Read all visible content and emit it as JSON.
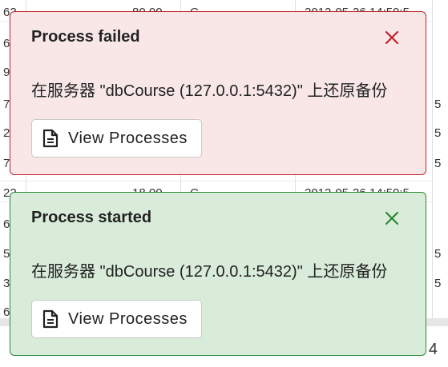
{
  "background": {
    "left_column_fragments": [
      "62",
      "6",
      "9",
      "7",
      "2",
      "7",
      "22",
      "6",
      "5",
      "3",
      "6"
    ],
    "mid_values": [
      "80.00",
      "18.00"
    ],
    "right_values": [
      "2012-05-26 14:59:5",
      "2012-05-26 14:59:5"
    ],
    "mid_letters": [
      "C",
      "C"
    ],
    "right_edge_fragments": [
      "5",
      "5",
      "5",
      "5",
      "5"
    ],
    "page_number": "4"
  },
  "toasts": [
    {
      "title": "Process failed",
      "message": "在服务器 \"dbCourse (127.0.0.1:5432)\" 上还原备份",
      "button_label": "View Processes",
      "close_color": "#c0202b",
      "status": "failed"
    },
    {
      "title": "Process started",
      "message": "在服务器 \"dbCourse (127.0.0.1:5432)\" 上还原备份",
      "button_label": "View Processes",
      "close_color": "#2a8a36",
      "status": "started"
    }
  ]
}
